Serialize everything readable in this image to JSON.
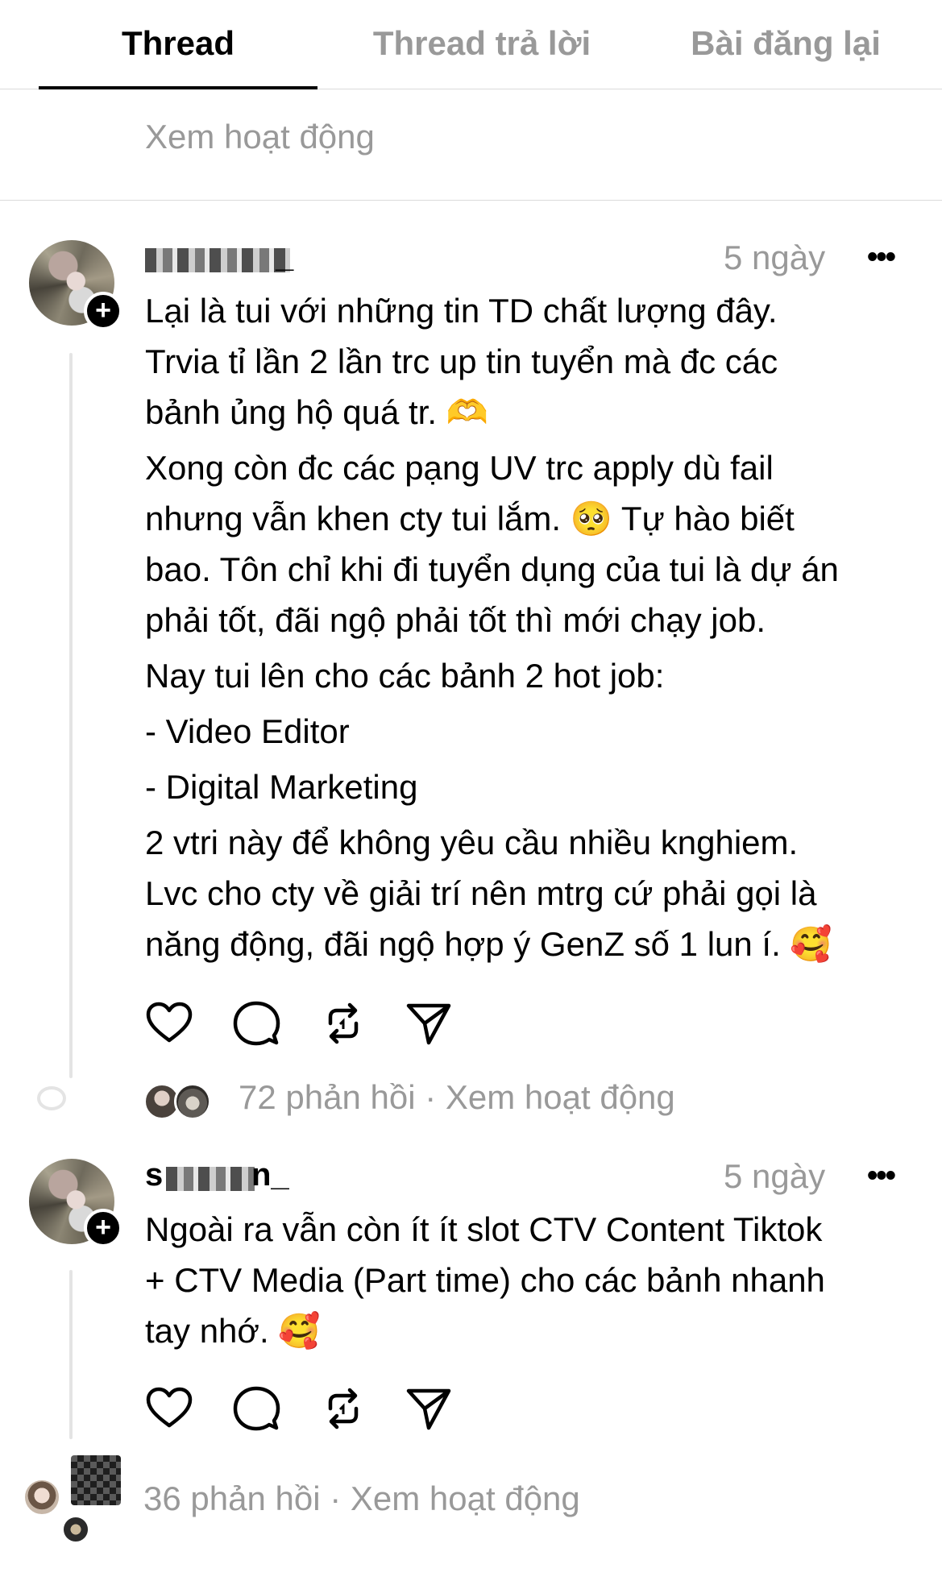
{
  "tabs": [
    {
      "label": "Thread",
      "active": true
    },
    {
      "label": "Thread trả lời",
      "active": false
    },
    {
      "label": "Bài đăng lại",
      "active": false
    }
  ],
  "top_activity_link": "Xem hoạt động",
  "posts": [
    {
      "username_visible": "_",
      "time": "5 ngày",
      "paragraphs": [
        [
          "Lại là tui với những tin TD chất lượng đây.",
          "Trvia tỉ lần 2 lần trc up tin tuyển mà đc các",
          "bảnh ủng hộ quá tr. 🫶"
        ],
        [
          "Xong còn đc các pạng UV trc apply dù fail",
          "nhưng vẫn khen cty tui lắm. 🥺  Tự hào biết",
          "bao. Tôn chỉ khi đi tuyển dụng của tui là dự án",
          "phải tốt, đãi ngộ phải tốt thì mới chạy job."
        ],
        [
          "Nay tui lên cho các bảnh 2 hot job:"
        ],
        [
          "- Video Editor"
        ],
        [
          "- Digital Marketing"
        ],
        [
          "2 vtri này để không yêu cầu nhiều knghiem.",
          "Lvc cho cty về giải trí nên mtrg cứ phải gọi là",
          "năng động, đãi ngộ hợp ý GenZ số 1 lun í. 🥰"
        ]
      ],
      "replies_count": "72 phản hồi",
      "separator": "·",
      "activity_link": "Xem hoạt động"
    },
    {
      "username_visible": "s",
      "username_tail": "n_",
      "time": "5 ngày",
      "paragraphs": [
        [
          "Ngoài ra vẫn còn ít ít slot CTV Content Tiktok",
          "+ CTV Media (Part time) cho các bảnh nhanh",
          "tay nhớ. 🥰"
        ]
      ],
      "replies_count": "36 phản hồi",
      "separator": "·",
      "activity_link": "Xem hoạt động"
    }
  ],
  "icons": {
    "like": "heart-icon",
    "comment": "comment-icon",
    "repost": "repost-icon",
    "share": "send-icon",
    "more": "more-icon",
    "follow": "plus-icon"
  },
  "colors": {
    "text": "#000000",
    "muted": "#999999",
    "divider": "#dbdbdb",
    "thread_line": "#e4e4e4"
  }
}
